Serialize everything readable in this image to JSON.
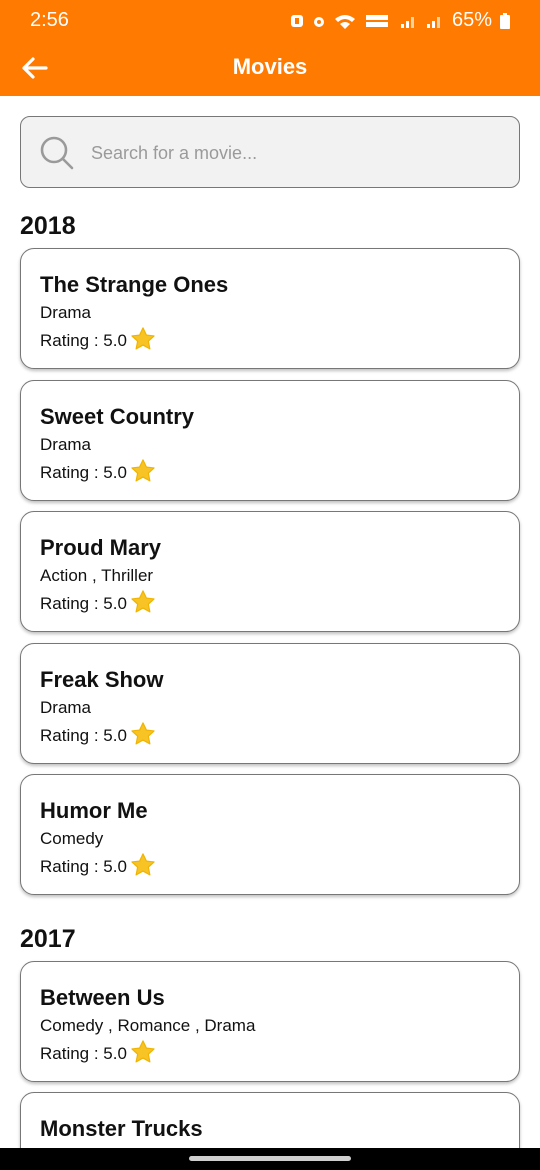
{
  "status_bar": {
    "time": "2:56",
    "battery": "65%"
  },
  "header": {
    "title": "Movies"
  },
  "search": {
    "placeholder": "Search for a movie..."
  },
  "sections": [
    {
      "year": "2018",
      "movies": [
        {
          "title": "The Strange Ones",
          "genre": "Drama",
          "rating": "Rating : 5.0"
        },
        {
          "title": "Sweet Country",
          "genre": "Drama",
          "rating": "Rating : 5.0"
        },
        {
          "title": "Proud Mary",
          "genre": "Action , Thriller",
          "rating": "Rating : 5.0"
        },
        {
          "title": "Freak Show",
          "genre": "Drama",
          "rating": "Rating : 5.0"
        },
        {
          "title": "Humor Me",
          "genre": "Comedy",
          "rating": "Rating : 5.0"
        }
      ]
    },
    {
      "year": "2017",
      "movies": [
        {
          "title": "Between Us",
          "genre": "Comedy , Romance , Drama",
          "rating": "Rating : 5.0"
        },
        {
          "title": "Monster Trucks",
          "genre": "",
          "rating": ""
        }
      ]
    }
  ],
  "colors": {
    "accent": "#ff7a00",
    "star": "#f7c325",
    "card_border": "#777777"
  }
}
